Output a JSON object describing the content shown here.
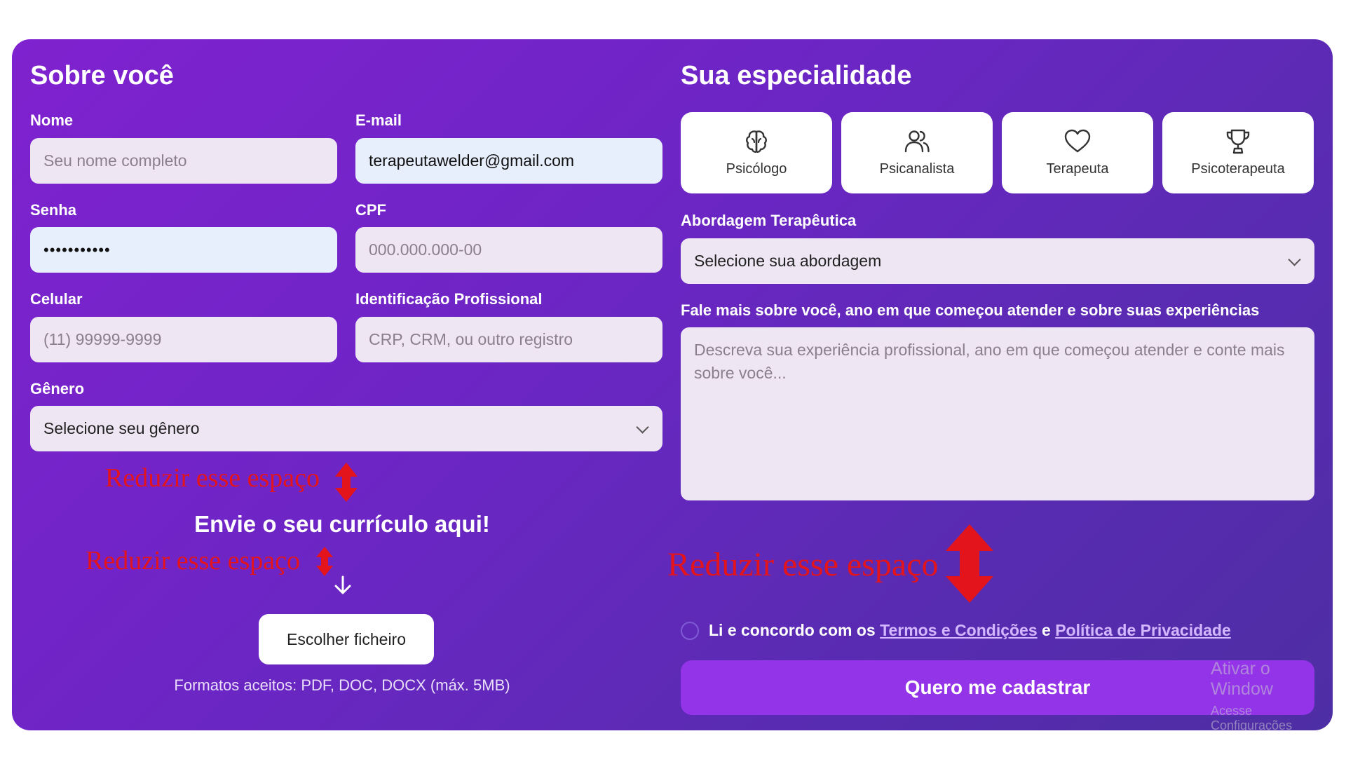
{
  "about": {
    "title": "Sobre você",
    "nome": {
      "label": "Nome",
      "placeholder": "Seu nome completo"
    },
    "email": {
      "label": "E-mail",
      "value": "terapeutawelder@gmail.com"
    },
    "senha": {
      "label": "Senha",
      "value": "•••••••••••"
    },
    "cpf": {
      "label": "CPF",
      "placeholder": "000.000.000-00"
    },
    "celular": {
      "label": "Celular",
      "placeholder": "(11) 99999-9999"
    },
    "identificacao": {
      "label": "Identificação Profissional",
      "placeholder": "CRP, CRM, ou outro registro"
    },
    "genero": {
      "label": "Gênero",
      "selected": "Selecione seu gênero"
    }
  },
  "upload": {
    "title": "Envie o seu currículo aqui!",
    "button": "Escolher ficheiro",
    "formats": "Formatos aceitos: PDF, DOC, DOCX (máx. 5MB)"
  },
  "specialty": {
    "title": "Sua especialidade",
    "options": [
      {
        "label": "Psicólogo",
        "icon": "brain-icon"
      },
      {
        "label": "Psicanalista",
        "icon": "users-icon"
      },
      {
        "label": "Terapeuta",
        "icon": "heart-icon"
      },
      {
        "label": "Psicoterapeuta",
        "icon": "trophy-icon"
      }
    ],
    "abordagem": {
      "label": "Abordagem Terapêutica",
      "selected": "Selecione sua abordagem"
    },
    "sobre": {
      "label": "Fale mais sobre você, ano em que começou atender e sobre suas experiências",
      "placeholder": "Descreva sua experiência profissional, ano em que começou atender e conte mais sobre você..."
    }
  },
  "terms": {
    "prefix": "Li e concordo com os",
    "link1": "Termos e Condições",
    "middle": "e",
    "link2": "Política de Privacidade"
  },
  "submit_label": "Quero me cadastrar",
  "annotations": {
    "a1": "Reduzir esse espaço",
    "a2": "Reduzir esse espaço",
    "a3": "Reduzir esse espaço"
  },
  "watermark": {
    "line1": "Ativar o Window",
    "line2": "Acesse Configurações"
  },
  "colors": {
    "card_start": "#7f22cf",
    "card_end": "#4e2ea4",
    "submit": "#9334e8",
    "annotation": "#e4141c",
    "link": "#d4b8ff"
  }
}
